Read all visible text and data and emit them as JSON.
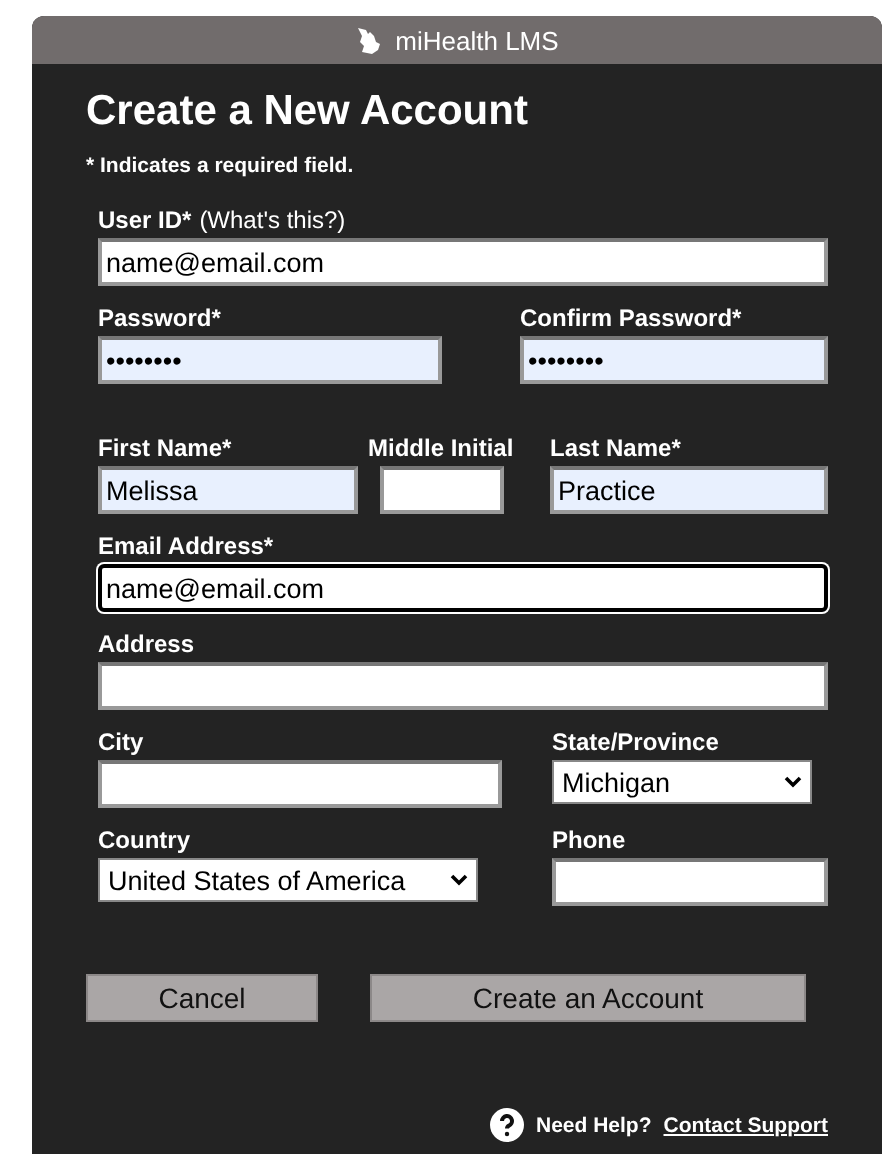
{
  "header": {
    "title": "miHealth LMS"
  },
  "heading": "Create a New Account",
  "note": "* Indicates a required field.",
  "rows": [
    [
      {
        "kind": "text",
        "label": "User ID*",
        "hint": "(What's this?)",
        "value": "name@email.com",
        "autofilled": false,
        "focused": false
      }
    ],
    [
      {
        "kind": "text",
        "label": "Password*",
        "value": "••••••••",
        "autofilled": true,
        "focused": false
      },
      {
        "kind": "text",
        "label": "Confirm Password*",
        "value": "••••••••",
        "autofilled": true,
        "focused": false
      }
    ],
    [
      {
        "kind": "text",
        "label": "First Name*",
        "value": "Melissa",
        "autofilled": true,
        "focused": false
      },
      {
        "kind": "text",
        "label": "Middle Initial",
        "autofilled": false,
        "focused": false
      },
      {
        "kind": "text",
        "label": "Last Name*",
        "value": "Practice",
        "autofilled": true,
        "focused": false
      }
    ],
    [
      {
        "kind": "text",
        "label": "Email Address*",
        "value": "name@email.com",
        "autofilled": false,
        "focused": true
      }
    ],
    [
      {
        "kind": "text",
        "label": "Address",
        "autofilled": false,
        "focused": false
      }
    ],
    [
      {
        "kind": "text",
        "label": "City",
        "autofilled": false,
        "focused": false
      },
      {
        "kind": "select",
        "label": "State/Province",
        "value": "Michigan"
      }
    ],
    [
      {
        "kind": "select",
        "label": "Country",
        "value": "United States of America"
      },
      {
        "kind": "text",
        "label": "Phone",
        "autofilled": false,
        "focused": false
      }
    ]
  ],
  "buttons": [
    "Cancel",
    "Create an Account"
  ],
  "help": {
    "text": "Need Help?",
    "link": "Contact Support"
  }
}
